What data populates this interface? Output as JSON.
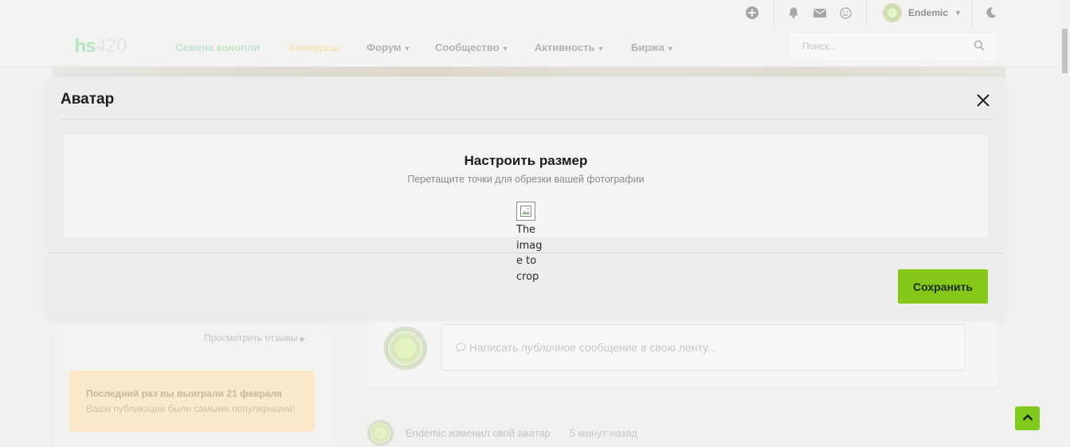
{
  "topbar": {
    "user_name": "Endemic"
  },
  "nav": {
    "logo_hs": "hs",
    "logo_420": "420",
    "items": [
      {
        "label": "Семена конопли"
      },
      {
        "label": "Конкурсы"
      },
      {
        "label": "Форум"
      },
      {
        "label": "Сообщество"
      },
      {
        "label": "Активность"
      },
      {
        "label": "Биржа"
      }
    ],
    "search_placeholder": "Поиск..."
  },
  "left": {
    "reviews_link": "Просмотреть отзывы",
    "win_title": "Последний раз вы выиграли 21 февраля",
    "win_text": "Ваши публикации были самыми популярными!"
  },
  "feed": {
    "input_prefix": "Написать ",
    "input_em": "публичное",
    "input_suffix": " сообщение в свою ленту...",
    "activity_text": "Endemic изменил свой аватар",
    "activity_time": "5 минут назад"
  },
  "modal": {
    "title": "Аватар",
    "crop_title": "Настроить размер",
    "crop_subtitle": "Перетащите точки для обрезки вашей фотографии",
    "image_alt": "The image to crop",
    "save_label": "Сохранить"
  },
  "colors": {
    "accent": "#85c81a",
    "modal_bg": "#edeeeb",
    "win_card": "#fbe9c9"
  },
  "icons": {
    "topbar": [
      "plus-circle-icon",
      "bell-icon",
      "envelope-icon",
      "smile-icon",
      "moon-icon"
    ],
    "search": "search-icon",
    "close": "close-icon",
    "scroll_top": "chevron-up-icon"
  }
}
